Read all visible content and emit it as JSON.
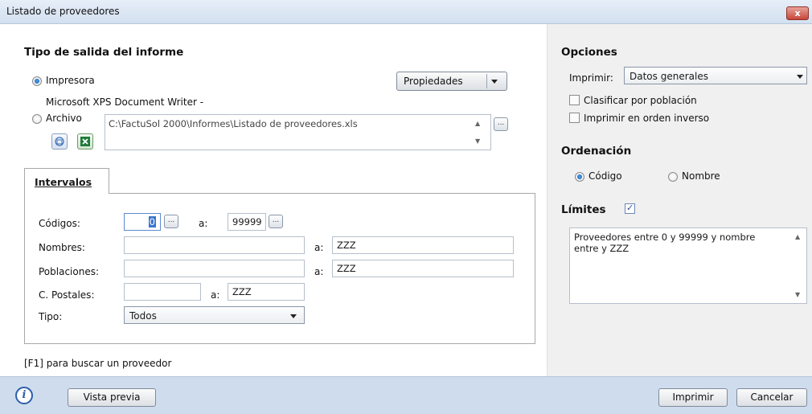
{
  "window": {
    "title": "Listado de proveedores",
    "close_label": "x"
  },
  "output": {
    "section_title": "Tipo de salida del informe",
    "printer_label": "Impresora",
    "printer_name": "Microsoft XPS Document Writer -",
    "properties_label": "Propiedades",
    "file_label": "Archivo",
    "file_path": "C:\\FactuSol 2000\\Informes\\Listado de proveedores.xls",
    "browse_label": "...",
    "selected": "Impresora"
  },
  "intervals": {
    "tab_label": "Intervalos",
    "codes_label": "Códigos:",
    "codes_from": "0",
    "codes_to": "99999",
    "names_label": "Nombres:",
    "names_from": "",
    "names_to": "ZZZ",
    "towns_label": "Poblaciones:",
    "towns_from": "",
    "towns_to": "ZZZ",
    "postal_label": "C. Postales:",
    "postal_from": "",
    "postal_to": "ZZZ",
    "type_label": "Tipo:",
    "type_value": "Todos",
    "a_label": "a:",
    "dots": "..."
  },
  "hint": "[F1] para buscar un proveedor",
  "options": {
    "title": "Opciones",
    "print_label": "Imprimir:",
    "print_value": "Datos generales",
    "classify_label": "Clasificar por población",
    "classify_checked": false,
    "reverse_label": "Imprimir en orden inverso",
    "reverse_checked": false
  },
  "ordering": {
    "title": "Ordenación",
    "code_label": "Código",
    "name_label": "Nombre",
    "selected": "Código"
  },
  "limits": {
    "title": "Límites",
    "checked": true,
    "summary": "Proveedores entre 0 y 99999 y nombre entre  y ZZZ"
  },
  "footer": {
    "preview_label": "Vista previa",
    "print_label": "Imprimir",
    "cancel_label": "Cancelar",
    "info_glyph": "i"
  }
}
